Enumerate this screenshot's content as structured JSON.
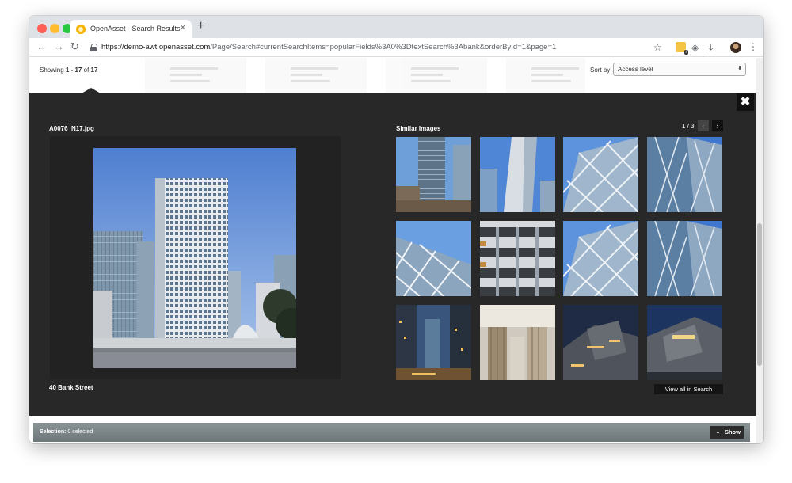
{
  "browser": {
    "tab_title": "OpenAsset - Search Results",
    "tab_close": "×",
    "new_tab": "+",
    "url_host": "https://demo-awt.openasset.com",
    "url_path": "/Page/Search#currentSearchItems=popularFields%3A0%3DtextSearch%3Abank&orderById=1&page=1",
    "extension_badge": "7"
  },
  "results": {
    "showing_prefix": "Showing ",
    "showing_range": "1 - 17",
    "showing_of": " of ",
    "showing_total": "17",
    "sort_label": "Sort by:",
    "sort_value": "Access level"
  },
  "preview": {
    "close_label": "✖",
    "filename": "A0076_N17.jpg",
    "caption": "40 Bank Street",
    "similar_title": "Similar Images",
    "pager": "1 / 3",
    "prev_label": "‹",
    "next_label": "›",
    "view_all_label": "View all in Search"
  },
  "selection": {
    "label": "Selection:",
    "status": " 0 selected",
    "show_label": "Show",
    "show_icon": "▲"
  },
  "thumbs": [
    {
      "kind": "tower-pair"
    },
    {
      "kind": "tower-up"
    },
    {
      "kind": "diagrid-close"
    },
    {
      "kind": "diagrid-tall"
    },
    {
      "kind": "diagrid-corner"
    },
    {
      "kind": "bands"
    },
    {
      "kind": "diagrid-close"
    },
    {
      "kind": "diagrid-tall"
    },
    {
      "kind": "street-dusk"
    },
    {
      "kind": "lobby"
    },
    {
      "kind": "night-block"
    },
    {
      "kind": "night-sign"
    }
  ],
  "colors": {
    "preview_bg": "#282828",
    "selection_bar": "#7c8588"
  }
}
